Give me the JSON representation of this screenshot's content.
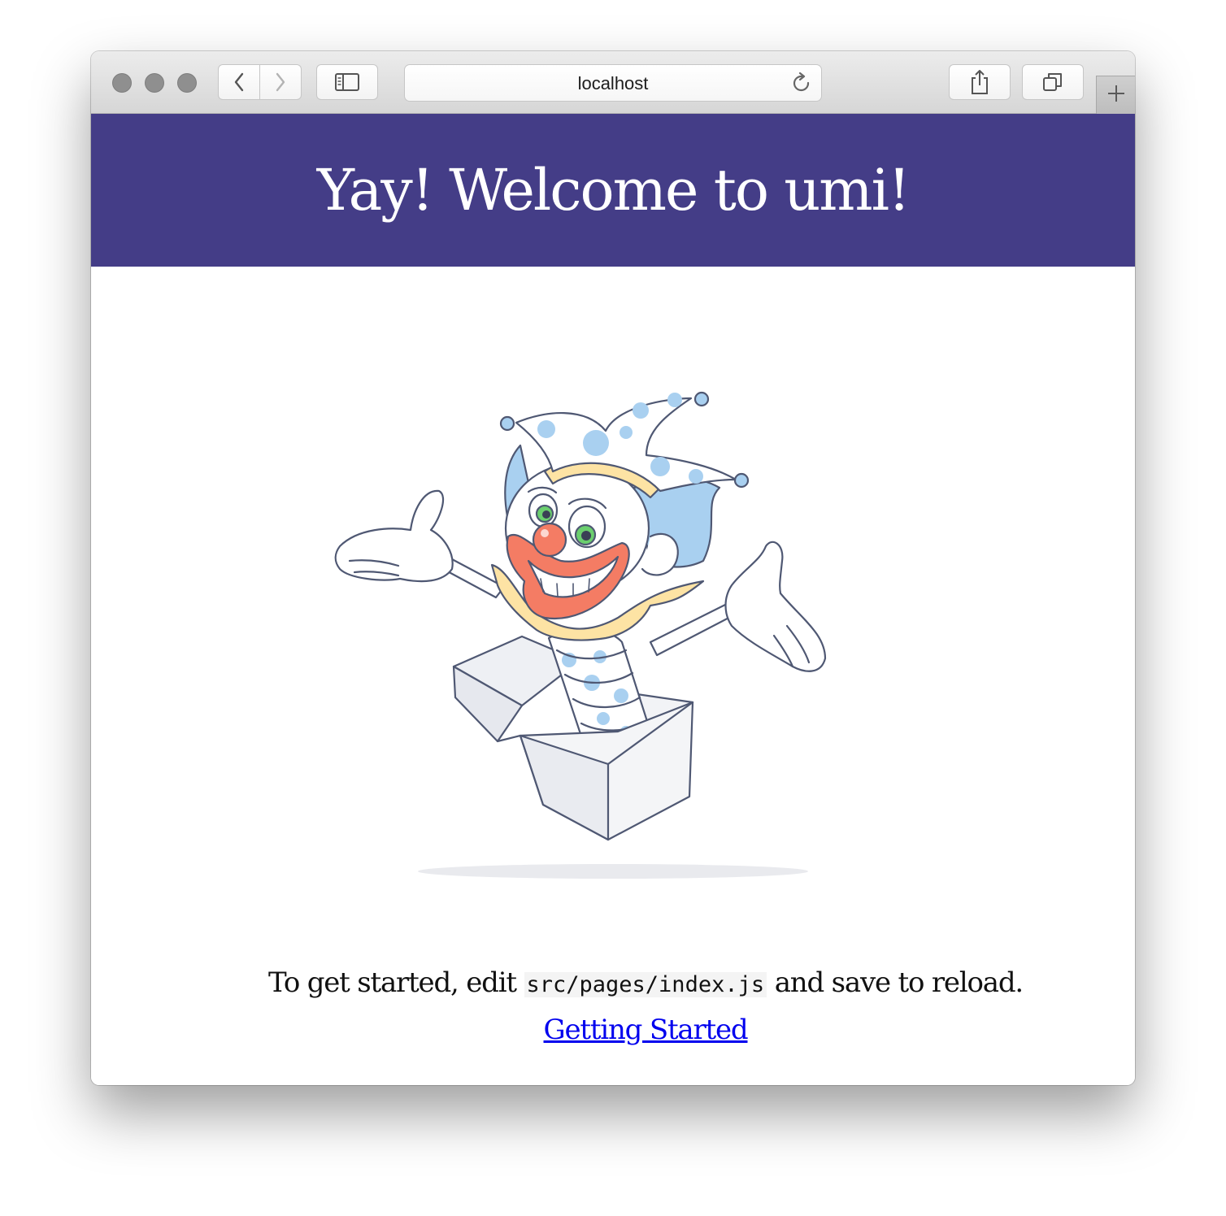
{
  "browser": {
    "address": "localhost",
    "colors": {
      "toolbar": "#dcdcdc",
      "traffic_light_inactive": "#8f8f8f"
    },
    "icons": {
      "back": "chevron-left-icon",
      "forward": "chevron-right-icon",
      "sidebar": "sidebar-icon",
      "reload": "reload-icon",
      "share": "share-icon",
      "tabs": "tabs-icon",
      "new_tab": "plus-icon"
    }
  },
  "page": {
    "title": "Yay! Welcome to umi!",
    "intro_before": "To get started, edit ",
    "intro_code": "src/pages/index.js",
    "intro_after": " and save to reload.",
    "link_label": "Getting Started",
    "colors": {
      "banner": "#443d87",
      "link": "#0000ee"
    }
  }
}
